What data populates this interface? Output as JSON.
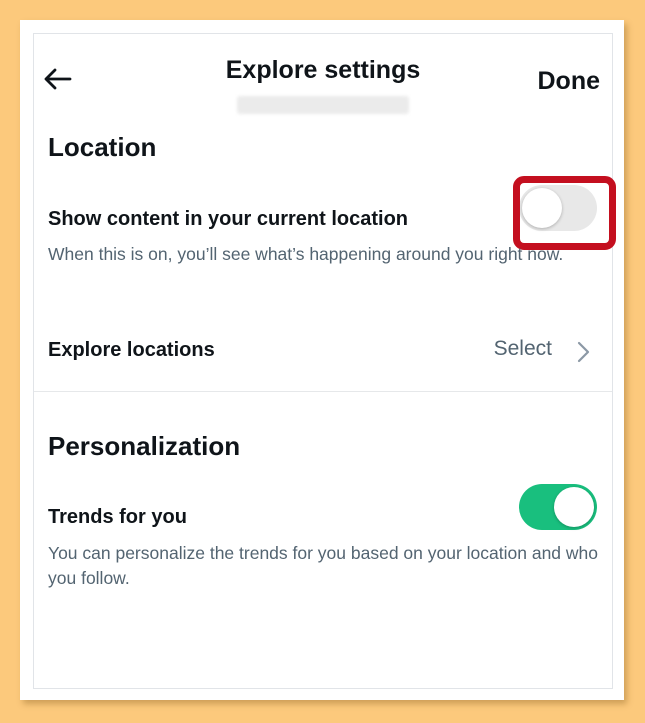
{
  "header": {
    "title": "Explore settings",
    "done_label": "Done"
  },
  "location": {
    "section_title": "Location",
    "show_content": {
      "label": "Show content in your current location",
      "description": "When this is on, you’ll see what’s happening around you right now.",
      "enabled": false
    },
    "explore_locations": {
      "label": "Explore locations",
      "value": "Select"
    }
  },
  "personalization": {
    "section_title": "Personalization",
    "trends": {
      "label": "Trends for you",
      "description": "You can personalize the trends for you based on your location and who you follow.",
      "enabled": true
    }
  },
  "colors": {
    "toggle_on": "#19bf7e",
    "toggle_off": "#e8e8e8",
    "highlight": "#c40f1f",
    "background": "#fcc97c"
  },
  "icons": {
    "back": "arrow-left-icon",
    "chevron": "chevron-right-icon"
  }
}
